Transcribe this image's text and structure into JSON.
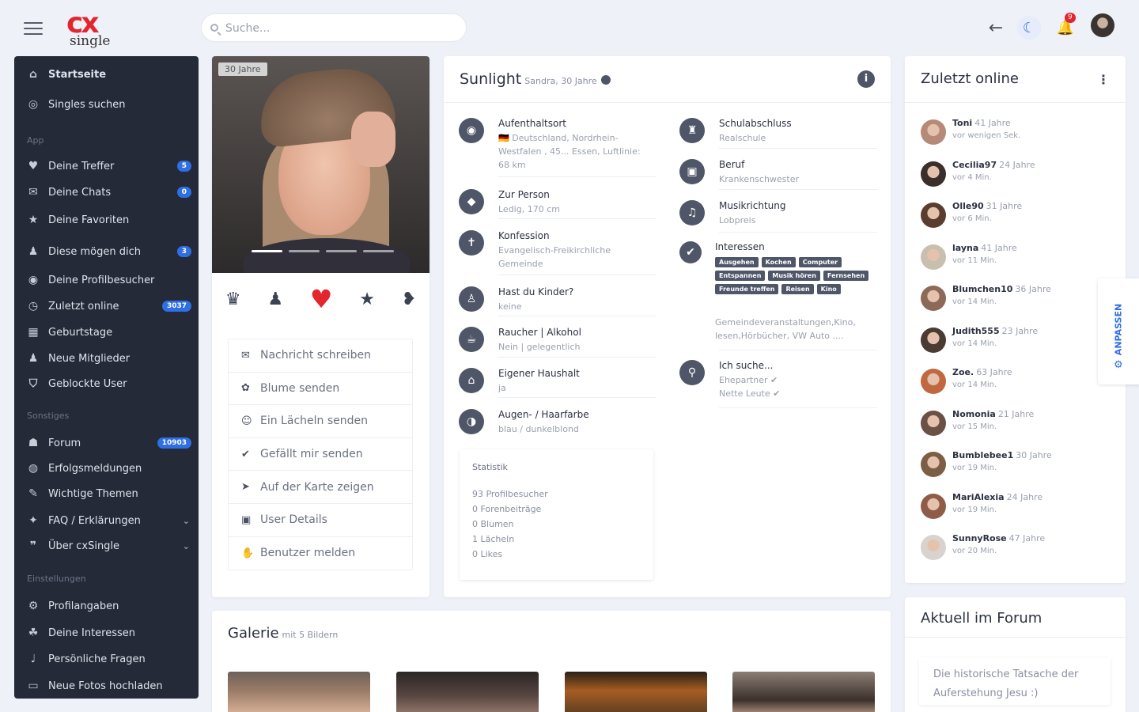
{
  "header": {
    "logo_text": "single",
    "search_placeholder": "Suche...",
    "notification_count": "9"
  },
  "sidebar": {
    "main": [
      {
        "label": "Startseite",
        "icon": "home-icon"
      },
      {
        "label": "Singles suchen",
        "icon": "binoculars-icon"
      }
    ],
    "section_app": "App",
    "app": [
      {
        "label": "Deine Treffer",
        "badge": "5"
      },
      {
        "label": "Deine Chats",
        "badge": "0"
      },
      {
        "label": "Deine Favoriten",
        "badge": ""
      },
      {
        "label": "Diese mögen dich",
        "badge": "3"
      },
      {
        "label": "Deine Profilbesucher",
        "badge": ""
      },
      {
        "label": "Zuletzt online",
        "badge": "3037"
      },
      {
        "label": "Geburtstage",
        "badge": ""
      },
      {
        "label": "Neue Mitglieder",
        "badge": ""
      },
      {
        "label": "Geblockte User",
        "badge": ""
      }
    ],
    "section_other": "Sonstiges",
    "other": [
      {
        "label": "Forum",
        "badge": "10903"
      },
      {
        "label": "Erfolgsmeldungen",
        "badge": ""
      },
      {
        "label": "Wichtige Themen",
        "badge": ""
      },
      {
        "label": "FAQ / Erklärungen",
        "badge": ""
      },
      {
        "label": "Über cxSingle",
        "badge": ""
      }
    ],
    "section_settings": "Einstellungen",
    "settings": [
      {
        "label": "Profilangaben"
      },
      {
        "label": "Deine Interessen"
      },
      {
        "label": "Persönliche Fragen"
      },
      {
        "label": "Neue Fotos hochladen"
      }
    ]
  },
  "profile": {
    "age_tag": "30 Jahre",
    "menu": [
      "Nachricht schreiben",
      "Blume senden",
      "Ein Lächeln senden",
      "Gefällt mir senden",
      "Auf der Karte zeigen",
      "User Details",
      "Benutzer melden"
    ]
  },
  "details": {
    "username": "Sunlight",
    "subtitle": "Sandra, 30 Jahre",
    "left": [
      {
        "label": "Aufenthaltsort",
        "value": "🇩🇪 Deutschland, Nordrhein-Westfalen , 45... Essen, Luftlinie: 68 km"
      },
      {
        "label": "Zur Person",
        "value": "Ledig, 170 cm"
      },
      {
        "label": "Konfession",
        "value": "Evangelisch-Freikirchliche Gemeinde"
      },
      {
        "label": "Hast du Kinder?",
        "value": "keine"
      },
      {
        "label": "Raucher | Alkohol",
        "value": "Nein | gelegentlich"
      },
      {
        "label": "Eigener Haushalt",
        "value": "ja"
      },
      {
        "label": "Augen- / Haarfarbe",
        "value": "blau / dunkelblond"
      }
    ],
    "right": [
      {
        "label": "Schulabschluss",
        "value": "Realschule"
      },
      {
        "label": "Beruf",
        "value": "Krankenschwester"
      },
      {
        "label": "Musikrichtung",
        "value": "Lobpreis"
      }
    ],
    "interests_label": "Interessen",
    "interests_tags": [
      "Ausgehen",
      "Kochen",
      "Computer",
      "Entspannen",
      "Musik hören",
      "Fernsehen",
      "Freunde treffen",
      "Reisen",
      "Kino"
    ],
    "interests_more": "Gemeindeveranstaltungen,Kino, lesen,Hörbücher, VW Auto ....",
    "search_label": "Ich suche...",
    "search_values": [
      "Ehepartner ✔",
      "Nette Leute ✔"
    ],
    "stats_title": "Statistik",
    "stats": [
      "93 Profilbesucher",
      "0 Forenbeiträge",
      "0 Blumen",
      "1 Lächeln",
      "0 Likes"
    ]
  },
  "online": {
    "title": "Zuletzt online",
    "users": [
      {
        "name": "Toni",
        "age": "41 Jahre",
        "time": "vor wenigen Sek.",
        "color": "#b58a78"
      },
      {
        "name": "Cecilia97",
        "age": "24 Jahre",
        "time": "vor 4 Min.",
        "color": "#3a2f2a"
      },
      {
        "name": "Olle90",
        "age": "31 Jahre",
        "time": "vor 6 Min.",
        "color": "#5a3d2e"
      },
      {
        "name": "layna",
        "age": "41 Jahre",
        "time": "vor 11 Min.",
        "color": "#c9bfae"
      },
      {
        "name": "Blumchen10",
        "age": "36 Jahre",
        "time": "vor 14 Min.",
        "color": "#8d6a58"
      },
      {
        "name": "Judith555",
        "age": "23 Jahre",
        "time": "vor 14 Min.",
        "color": "#4a3b33"
      },
      {
        "name": "Zoe.",
        "age": "63 Jahre",
        "time": "vor 14 Min.",
        "color": "#c0683e"
      },
      {
        "name": "Nomonia",
        "age": "21 Jahre",
        "time": "vor 15 Min.",
        "color": "#6b5046"
      },
      {
        "name": "Bumblebee1",
        "age": "30 Jahre",
        "time": "vor 19 Min.",
        "color": "#7c5e44"
      },
      {
        "name": "MariAlexia",
        "age": "24 Jahre",
        "time": "vor 19 Min.",
        "color": "#8f5c48"
      },
      {
        "name": "SunnyRose",
        "age": "47 Jahre",
        "time": "vor 20 Min.",
        "color": "#d8d3cf"
      }
    ],
    "anpassen": "ANPASSEN"
  },
  "gallery": {
    "title": "Galerie",
    "subtitle": "mit 5 Bildern"
  },
  "forum": {
    "title": "Aktuell im Forum",
    "post": "Die historische Tatsache der Auferstehung Jesu :)"
  }
}
